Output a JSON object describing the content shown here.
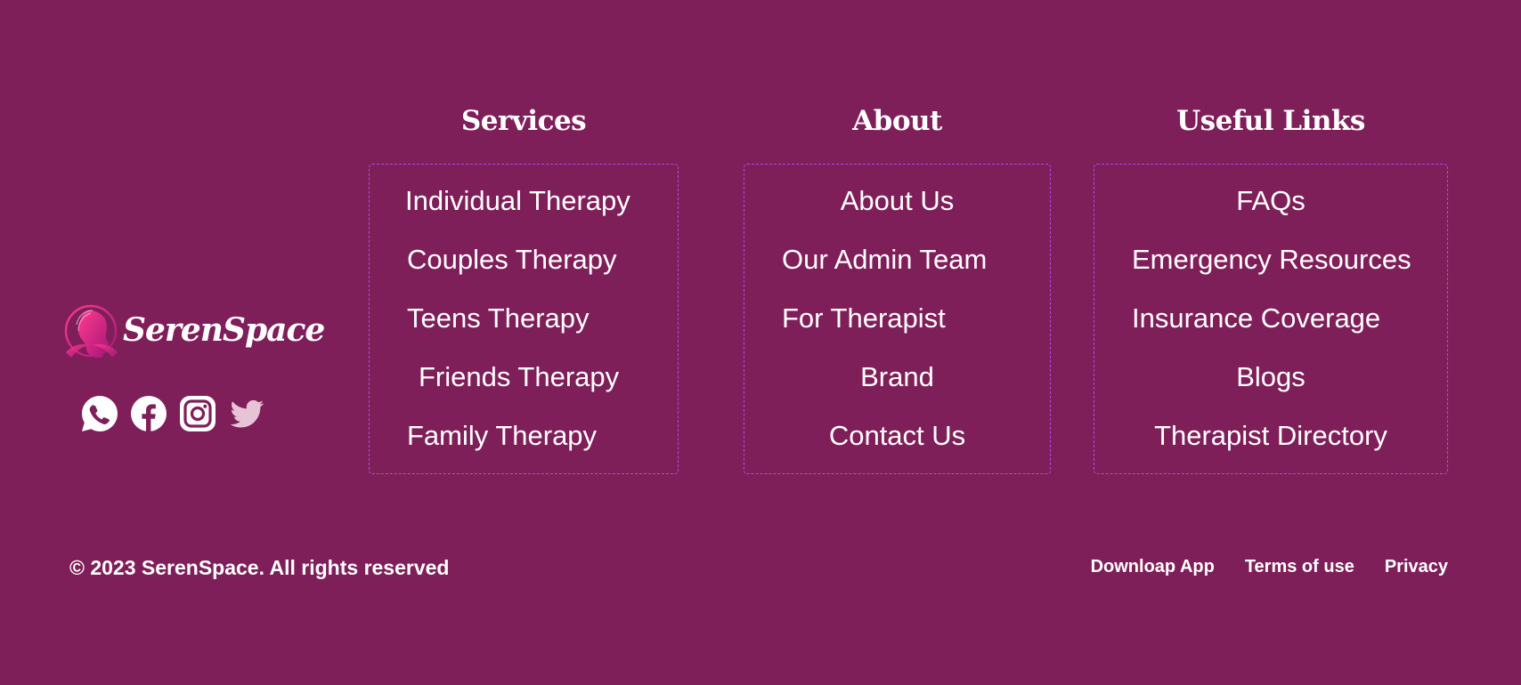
{
  "brand": {
    "name": "SerenSpace",
    "logo_icon": "woman-profile-icon",
    "social": [
      {
        "name": "whatsapp-icon"
      },
      {
        "name": "facebook-icon"
      },
      {
        "name": "instagram-icon"
      },
      {
        "name": "twitter-icon"
      }
    ]
  },
  "columns": {
    "services": {
      "title": "Services",
      "items": [
        "Individual Therapy",
        "Couples Therapy",
        "Teens Therapy",
        "Friends Therapy",
        "Family Therapy"
      ]
    },
    "about": {
      "title": "About",
      "items": [
        "About Us",
        "Our  Admin Team",
        "For Therapist",
        "Brand",
        "Contact Us"
      ]
    },
    "useful": {
      "title": "Useful Links",
      "items": [
        "FAQs",
        "Emergency Resources",
        "Insurance Coverage",
        "Blogs",
        "Therapist Directory"
      ]
    }
  },
  "footer": {
    "copyright": "© 2023 SerenSpace. All rights reserved",
    "links": [
      "Downloap App",
      "Terms of use",
      "Privacy"
    ]
  },
  "colors": {
    "background": "#7f1f5a",
    "box_border": "#a84fe0",
    "text": "#ffffff",
    "icon_light": "#ffffff",
    "icon_muted": "#e7c3d6",
    "logo_gradient_start": "#ff3b8d",
    "logo_gradient_end": "#a6157b"
  }
}
